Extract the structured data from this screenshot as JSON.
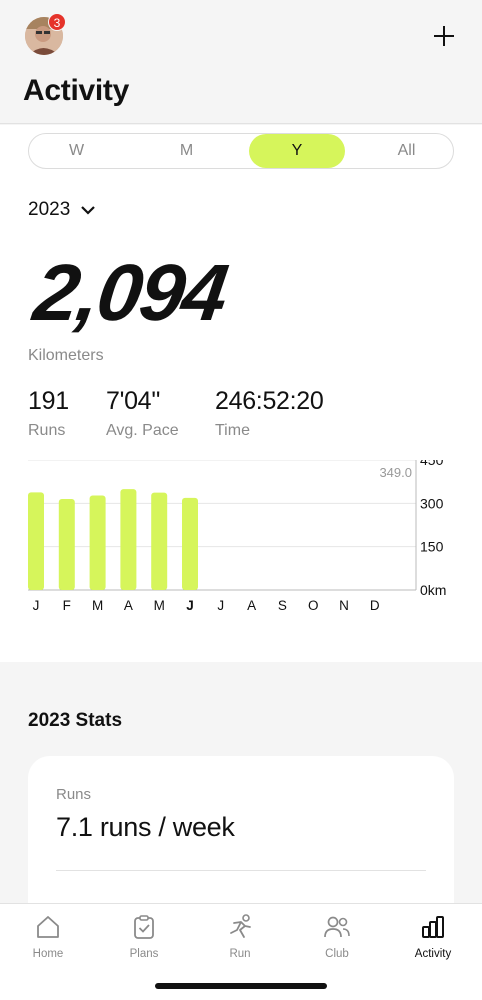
{
  "header": {
    "title": "Activity",
    "notification_count": "3"
  },
  "segments": {
    "items": [
      "W",
      "M",
      "Y",
      "All"
    ],
    "active": "Y"
  },
  "year_selector": "2023",
  "total": {
    "value": "2,094",
    "unit": "Kilometers"
  },
  "stats": [
    {
      "value": "191",
      "label": "Runs"
    },
    {
      "value": "7'04''",
      "label": "Avg. Pace"
    },
    {
      "value": "246:52:20",
      "label": "Time"
    }
  ],
  "chart_data": {
    "type": "bar",
    "categories": [
      "J",
      "F",
      "M",
      "A",
      "M",
      "J",
      "J",
      "A",
      "S",
      "O",
      "N",
      "D"
    ],
    "values": [
      338,
      315,
      327,
      349,
      337,
      319,
      0,
      0,
      0,
      0,
      0,
      0
    ],
    "ylim": [
      0,
      450
    ],
    "yticks": [
      "450",
      "300",
      "150",
      "0km"
    ],
    "max_label": "349.0",
    "bar_color": "#d6f55b"
  },
  "year_stats": {
    "title": "2023 Stats",
    "runs_label": "Runs",
    "runs_value": "7.1 runs / week"
  },
  "tabbar": [
    {
      "label": "Home",
      "icon": "home-icon"
    },
    {
      "label": "Plans",
      "icon": "clipboard-check-icon"
    },
    {
      "label": "Run",
      "icon": "runner-icon"
    },
    {
      "label": "Club",
      "icon": "people-icon"
    },
    {
      "label": "Activity",
      "icon": "bar-chart-icon",
      "active": true
    }
  ],
  "colors": {
    "accent": "#d6f55b",
    "badge": "#e5332a"
  }
}
